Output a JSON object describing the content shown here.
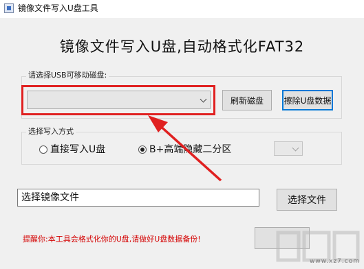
{
  "window": {
    "title": "镜像文件写入U盘工具"
  },
  "headline": "镜像文件写入U盘,自动格式化FAT32",
  "usb_group": {
    "label": "请选择USB可移动磁盘:",
    "selected_disk": "",
    "refresh_button": "刷新磁盘",
    "erase_button": "擦除U盘数据"
  },
  "mode_group": {
    "label": "选择写入方式",
    "options": [
      {
        "label": "直接写入U盘",
        "checked": false
      },
      {
        "label": "B+高端隐藏二分区",
        "checked": true
      }
    ],
    "partition_select_value": ""
  },
  "file": {
    "placeholder": "选择镜像文件",
    "browse_button": "选择文件"
  },
  "warning": "提醒你:本工具会格式化你的U盘,请做好U盘数据备份!",
  "start_button": "",
  "watermark": {
    "site": "www.xz7.com"
  },
  "colors": {
    "highlight": "#e02020",
    "warning": "#d40000",
    "default_button_border": "#0078d7"
  }
}
